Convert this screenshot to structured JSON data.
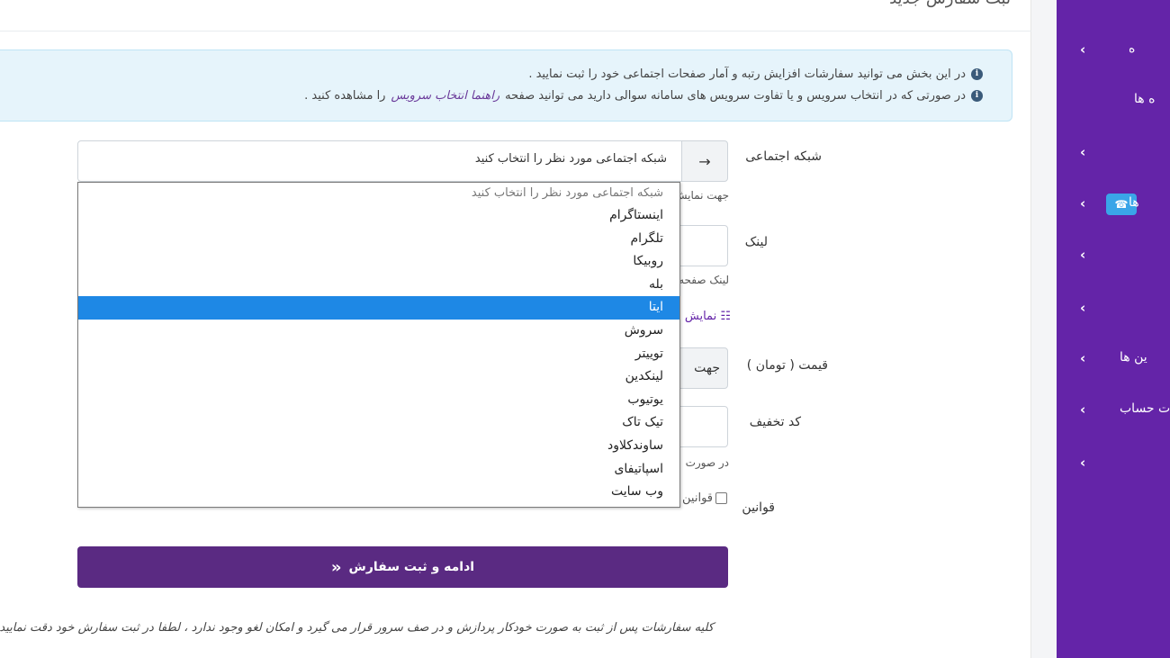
{
  "page": {
    "title": "ثبت سفارش جدید"
  },
  "alert": {
    "line1": "در این بخش می توانید سفارشات افزایش رتبه و آمار صفحات اجتماعی خود را ثبت نمایید .",
    "line2_before": "در صورتی که در انتخاب سرویس و یا تفاوت سرویس های سامانه سوالی دارید می توانید صفحه",
    "line2_link": "راهنما انتخاب سرویس",
    "line2_after": "را مشاهده کنید ."
  },
  "form": {
    "social_label": "شبکه اجتماعی",
    "social_selected": "شبکه اجتماعی مورد نظر را انتخاب کنید",
    "social_hint": "جهت نمایش",
    "link_label": "لینک",
    "link_hint": "لینک صفحه",
    "show_label": "نمایش",
    "price_label": "قیمت ( تومان )",
    "price_value": "جهت",
    "discount_label": "کد تخفیف",
    "discount_hint": "در صورت",
    "terms_label": "قوانین",
    "terms_checkbox_label": "قوانین",
    "submit_label": "ادامه و ثبت سفارش",
    "footer_note": "کلیه سفارشات پس از ثبت به صورت خودکار پردازش و در صف سرور قرار می گیرد و امکان لغو وجود ندارد ، لطفا در ثبت سفارش خود دقت نمایید ."
  },
  "dropdown": {
    "placeholder": "شبکه اجتماعی مورد نظر را انتخاب کنید",
    "selected_index": 4,
    "options": [
      "اینستاگرام",
      "تلگرام",
      "روبیکا",
      "بله",
      "ایتا",
      "سروش",
      "توییتر",
      "لینکدین",
      "یوتیوب",
      "تیک تاک",
      "ساوندکلاود",
      "اسپاتیفای",
      "وب سایت"
    ]
  },
  "sidebar": {
    "items": [
      {
        "label": "ه",
        "icon": "chevron-left-icon"
      },
      {
        "label": "ه ها",
        "icon": ""
      },
      {
        "label": "",
        "icon": "chevron-left-icon"
      },
      {
        "label": "ها",
        "icon": "chevron-left-icon",
        "badge": "headset-icon"
      },
      {
        "label": "",
        "icon": "chevron-left-icon"
      },
      {
        "label": "",
        "icon": "chevron-left-icon"
      },
      {
        "label": "ین ها",
        "icon": "chevron-left-icon"
      },
      {
        "label": "ت حساب",
        "icon": "chevron-left-icon"
      },
      {
        "label": "",
        "icon": "chevron-left-icon"
      }
    ],
    "color": "#6424a8",
    "badge_color": "#3aa5e8"
  },
  "colors": {
    "submit": "#5a2a82",
    "selected_option": "#1e88e5",
    "alert_bg": "#e6f4fb"
  }
}
